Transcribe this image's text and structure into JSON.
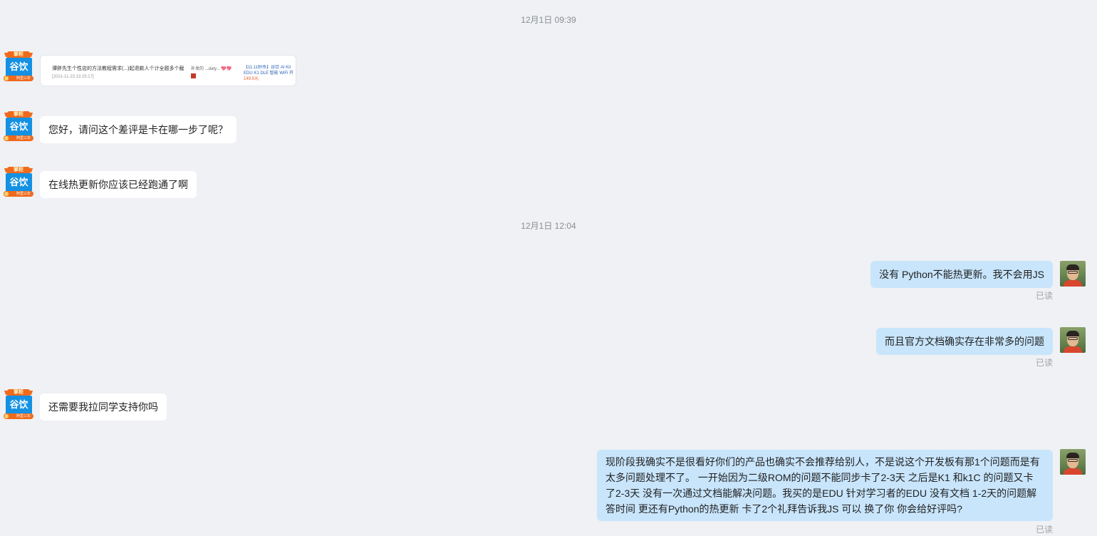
{
  "colors": {
    "background": "#eff1f4",
    "incoming_bubble": "#ffffff",
    "outgoing_bubble": "#c8e5fc",
    "seller_avatar_blue": "#1491e3",
    "seller_badge_orange": "#f06a1d"
  },
  "seller": {
    "avatar_badge": "掌柜",
    "avatar_name": "谷饮",
    "avatar_ribbon": "阿里三年"
  },
  "user": {
    "avatar_icon": "user-photo-avatar"
  },
  "messages": {
    "ts1": "12月1日 09:39",
    "card": {
      "title": "谭胖先生个性店的方法教程需求(...)⁠起退款人⁠个⁠计⁠全⁠题⁠多⁠个⁠截⁠图",
      "date": "[2021-11-23 13:25:17]",
      "middle": "补发的 ...daty...",
      "middle_highlight": "💖💖",
      "product": "【11.11秒杀】谷饮⁠ AI⁠ Kit⁠ EDU⁠ K1⁠ DLE⁠ 智能 WiFi 开发...",
      "price": "149.5元"
    },
    "m1": "您好，请问这个差评是卡在哪一步了呢？",
    "m2": "在线热更新你应该已经跑通了啊",
    "ts2": "12月1日 12:04",
    "u1": "没有 Python不能热更新。我不会用JS",
    "u1_status": "已读",
    "u2": "而且官方文档确实存在非常多的问题",
    "u2_status": "已读",
    "m3": "还需要我拉同学支持你吗",
    "u3_lines": [
      "现阶段我确实不是很看好你们的产品也确实不会推荐给别人，不是说这个开发板有那1个问题而是有",
      "太多问题处理不了。 一开始因为二级ROM的问题不能同步卡了2-3天 之后是K1 和k1C 的问题又卡",
      "了2-3天 没有一次通过文档能解决问题。我买的是EDU 针对学习者的EDU 没有文档 1-2天的问题解",
      "答时间 更还有Python的热更新 卡了2个礼拜告诉我JS 可以 换了你 你会给好评吗?"
    ],
    "u3_status": "已读"
  }
}
